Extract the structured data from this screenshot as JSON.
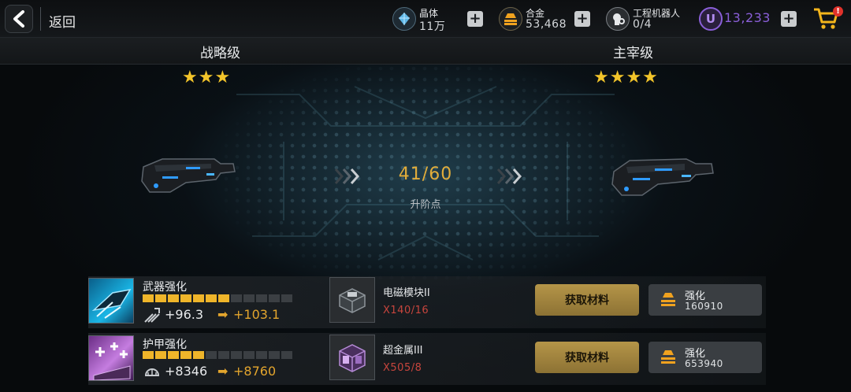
{
  "header": {
    "back_label": "返回",
    "resources": [
      {
        "name": "晶体",
        "value": "11万",
        "icon": "crystal-icon"
      },
      {
        "name": "合金",
        "value": "53,468",
        "icon": "alloy-icon"
      },
      {
        "name": "工程机器人",
        "value": "0/4",
        "icon": "robot-icon"
      }
    ],
    "premium": {
      "symbol": "U",
      "value": "13,233",
      "color": "#8a5fd8"
    },
    "cart_badge": "!"
  },
  "ranks": {
    "current": {
      "label": "战略级",
      "stars": "★★★"
    },
    "next": {
      "label": "主宰级",
      "stars": "★★★★"
    }
  },
  "progress": {
    "value": "41/60",
    "label": "升阶点"
  },
  "upgrades": [
    {
      "title": "武器强化",
      "bar_filled": 7,
      "bar_total": 12,
      "stat_icon": "weapon-stat-icon",
      "stat_current": "+96.3",
      "stat_arrow": "➡",
      "stat_next": "+103.1",
      "material_name": "电磁模块II",
      "material_count": "X140/16",
      "get_button": "获取材料",
      "upgrade_label": "强化",
      "upgrade_cost": "160910"
    },
    {
      "title": "护甲强化",
      "bar_filled": 5,
      "bar_total": 12,
      "stat_icon": "armor-stat-icon",
      "stat_current": "+8346",
      "stat_arrow": "➡",
      "stat_next": "+8760",
      "material_name": "超金属III",
      "material_count": "X505/8",
      "get_button": "获取材料",
      "upgrade_label": "强化",
      "upgrade_cost": "653940"
    }
  ],
  "colors": {
    "gold": "#efb52a",
    "accent_orange": "#e3a52d",
    "warning_red": "#c7453d",
    "star": "#f2c42a"
  }
}
